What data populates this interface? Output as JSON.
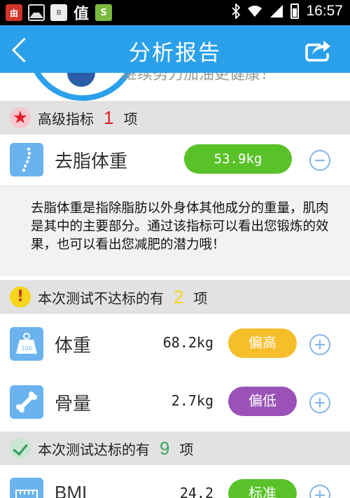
{
  "status_bar": {
    "time": "16:57"
  },
  "header": {
    "title": "分析报告",
    "back_icon": "chevron-left-icon",
    "share_icon": "share-icon"
  },
  "top_peek": {
    "text": "继续努力加油更健康！"
  },
  "sections": {
    "advanced": {
      "title": "高级指标",
      "count": "1",
      "unit": "项",
      "count_color": "#e3202e"
    },
    "substandard": {
      "title": "本次测试不达标的有",
      "count": "2",
      "unit": "项",
      "count_color": "#f2d21b"
    },
    "standard": {
      "title": "本次测试达标的有",
      "count": "9",
      "unit": "项",
      "count_color": "#3aa35a"
    }
  },
  "rows": {
    "lean_mass": {
      "label": "去脂体重",
      "value": "53.9kg",
      "icon": "spine-icon"
    },
    "weight": {
      "label": "体重",
      "value": "68.2kg",
      "status": "偏高",
      "icon": "weight-icon"
    },
    "bone": {
      "label": "骨量",
      "value": "2.7kg",
      "status": "偏低",
      "icon": "bone-icon"
    },
    "bmi": {
      "label": "BMI",
      "value": "24.2",
      "status": "标准",
      "icon": "bmi-icon"
    }
  },
  "description": "去脂体重是指除脂肪以外身体其他成分的重量，肌肉是其中的主要部分。通过该指标可以看出您锻炼的效果，也可以看出您减肥的潜力哦！",
  "colors": {
    "header": "#2aa0ea",
    "green": "#59c229",
    "high": "#f7be2b",
    "low": "#9a52b8"
  }
}
